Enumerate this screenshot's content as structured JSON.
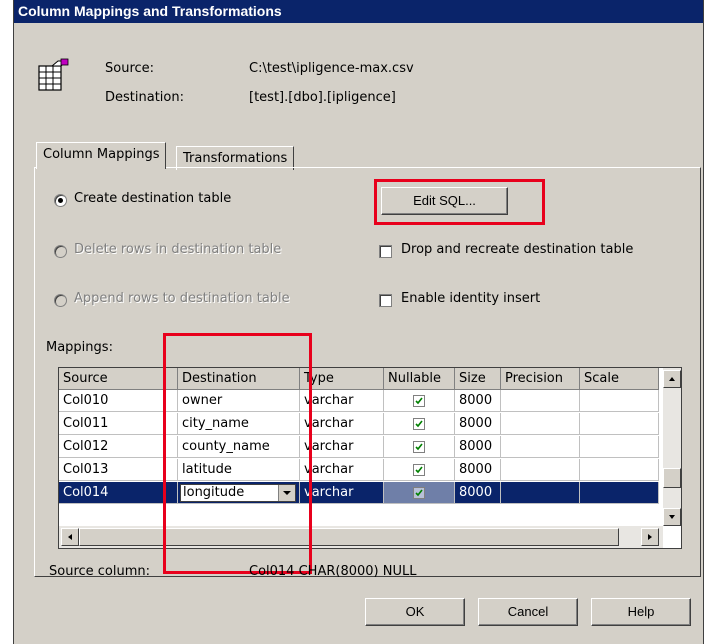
{
  "window": {
    "title": "Column Mappings and Transformations"
  },
  "info": {
    "source_label": "Source:",
    "source_value": "C:\\test\\ipligence-max.csv",
    "destination_label": "Destination:",
    "destination_value": "[test].[dbo].[ipligence]"
  },
  "tabs": [
    {
      "label": "Column Mappings",
      "active": true
    },
    {
      "label": "Transformations",
      "active": false
    }
  ],
  "options": {
    "create_table": "Create destination table",
    "delete_rows": "Delete rows in destination table",
    "append_rows": "Append rows to destination table",
    "edit_sql": "Edit SQL...",
    "drop_recreate": "Drop and recreate destination table",
    "identity_insert": "Enable identity insert"
  },
  "mappings": {
    "label": "Mappings:",
    "columns": [
      "Source",
      "Destination",
      "Type",
      "Nullable",
      "Size",
      "Precision",
      "Scale"
    ],
    "rows": [
      {
        "source": "Col010",
        "destination": "owner",
        "type": "varchar",
        "nullable": true,
        "size": "8000",
        "selected": false
      },
      {
        "source": "Col011",
        "destination": "city_name",
        "type": "varchar",
        "nullable": true,
        "size": "8000",
        "selected": false
      },
      {
        "source": "Col012",
        "destination": "county_name",
        "type": "varchar",
        "nullable": true,
        "size": "8000",
        "selected": false
      },
      {
        "source": "Col013",
        "destination": "latitude",
        "type": "varchar",
        "nullable": true,
        "size": "8000",
        "selected": false
      },
      {
        "source": "Col014",
        "destination": "longitude",
        "type": "varchar",
        "nullable": true,
        "size": "8000",
        "selected": true
      }
    ]
  },
  "status": {
    "source_column_label": "Source column:",
    "source_column_value": "Col014 CHAR(8000) NULL"
  },
  "buttons": {
    "ok": "OK",
    "cancel": "Cancel",
    "help": "Help"
  },
  "colors": {
    "titlebar": "#0a246a",
    "selection": "#0a246a",
    "highlight": "#e8001c",
    "face": "#d4d0c8"
  },
  "icons": {
    "table": "table-icon",
    "dropdown": "chevron-down-icon",
    "scroll_up": "arrow-up-icon",
    "scroll_down": "arrow-down-icon",
    "scroll_left": "arrow-left-icon",
    "scroll_right": "arrow-right-icon"
  }
}
